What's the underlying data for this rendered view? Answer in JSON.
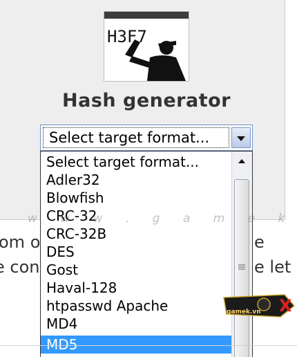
{
  "header": {
    "title": "Hash generator",
    "logo_text": "H3F7"
  },
  "select": {
    "value": "Select target format..."
  },
  "dropdown": {
    "options": [
      "Select target format...",
      "Adler32",
      "Blowfish",
      "CRC-32",
      "CRC-32B",
      "DES",
      "Gost",
      "Haval-128",
      "htpasswd Apache",
      "MD4",
      "MD5"
    ],
    "selected": "MD5"
  },
  "background_text": {
    "line1_left": "om o",
    "line1_right": "e",
    "line2_left": "e con",
    "line2_right": "e let"
  },
  "watermark": "w w w . g a m e k . v n",
  "badge": {
    "text": "gamek.vn",
    "mark": "X"
  },
  "colors": {
    "panel": "#eeeeee",
    "selected": "#3399ff",
    "select_border": "#6f8fc4"
  }
}
